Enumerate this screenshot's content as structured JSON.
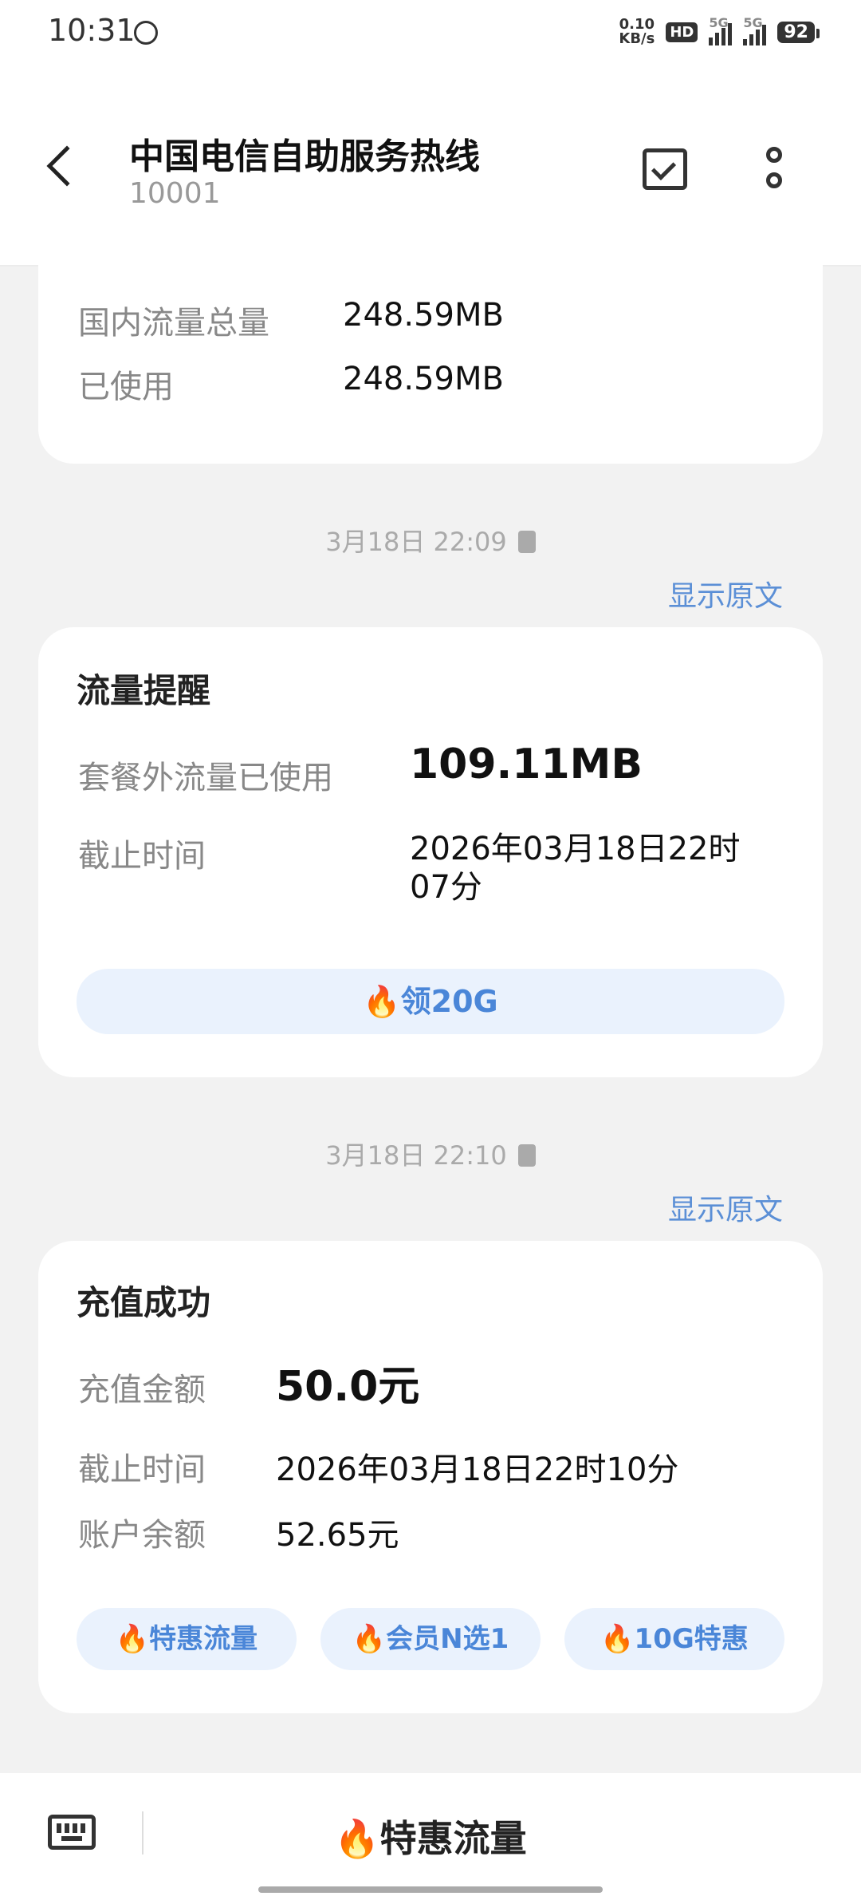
{
  "status_bar": {
    "time": "10:31",
    "net_speed_value": "0.10",
    "net_speed_unit": "KB/s",
    "hd_label": "HD",
    "sim1_label": "5G",
    "sim2_label": "5G",
    "battery": "92"
  },
  "header": {
    "title": "中国电信自助服务热线",
    "number": "10001"
  },
  "messages": {
    "m1": {
      "rows": [
        {
          "label": "国内流量总量",
          "value": "248.59MB"
        },
        {
          "label": "已使用",
          "value": "248.59MB"
        }
      ]
    },
    "m2": {
      "timestamp": "3月18日 22:09",
      "show_original": "显示原文",
      "title": "流量提醒",
      "row1_label": "套餐外流量已使用",
      "row1_value": "109.11MB",
      "row2_label": "截止时间",
      "row2_value_line1": "2026年03月18日22时",
      "row2_value_line2": "07分",
      "button_label": "领20G"
    },
    "m3": {
      "timestamp": "3月18日 22:10",
      "show_original": "显示原文",
      "title": "充值成功",
      "row1_label": "充值金额",
      "row1_value": "50.0元",
      "row2_label": "截止时间",
      "row2_value": "2026年03月18日22时10分",
      "row3_label": "账户余额",
      "row3_value": "52.65元",
      "buttons": [
        "特惠流量",
        "会员N选1",
        "10G特惠"
      ]
    }
  },
  "bottom_bar": {
    "action_label": "特惠流量"
  },
  "icons": {
    "fire": "🔥"
  },
  "colors": {
    "link": "#5b8fd6",
    "pill_bg": "#eaf2fd",
    "pill_text": "#4a86d8"
  }
}
